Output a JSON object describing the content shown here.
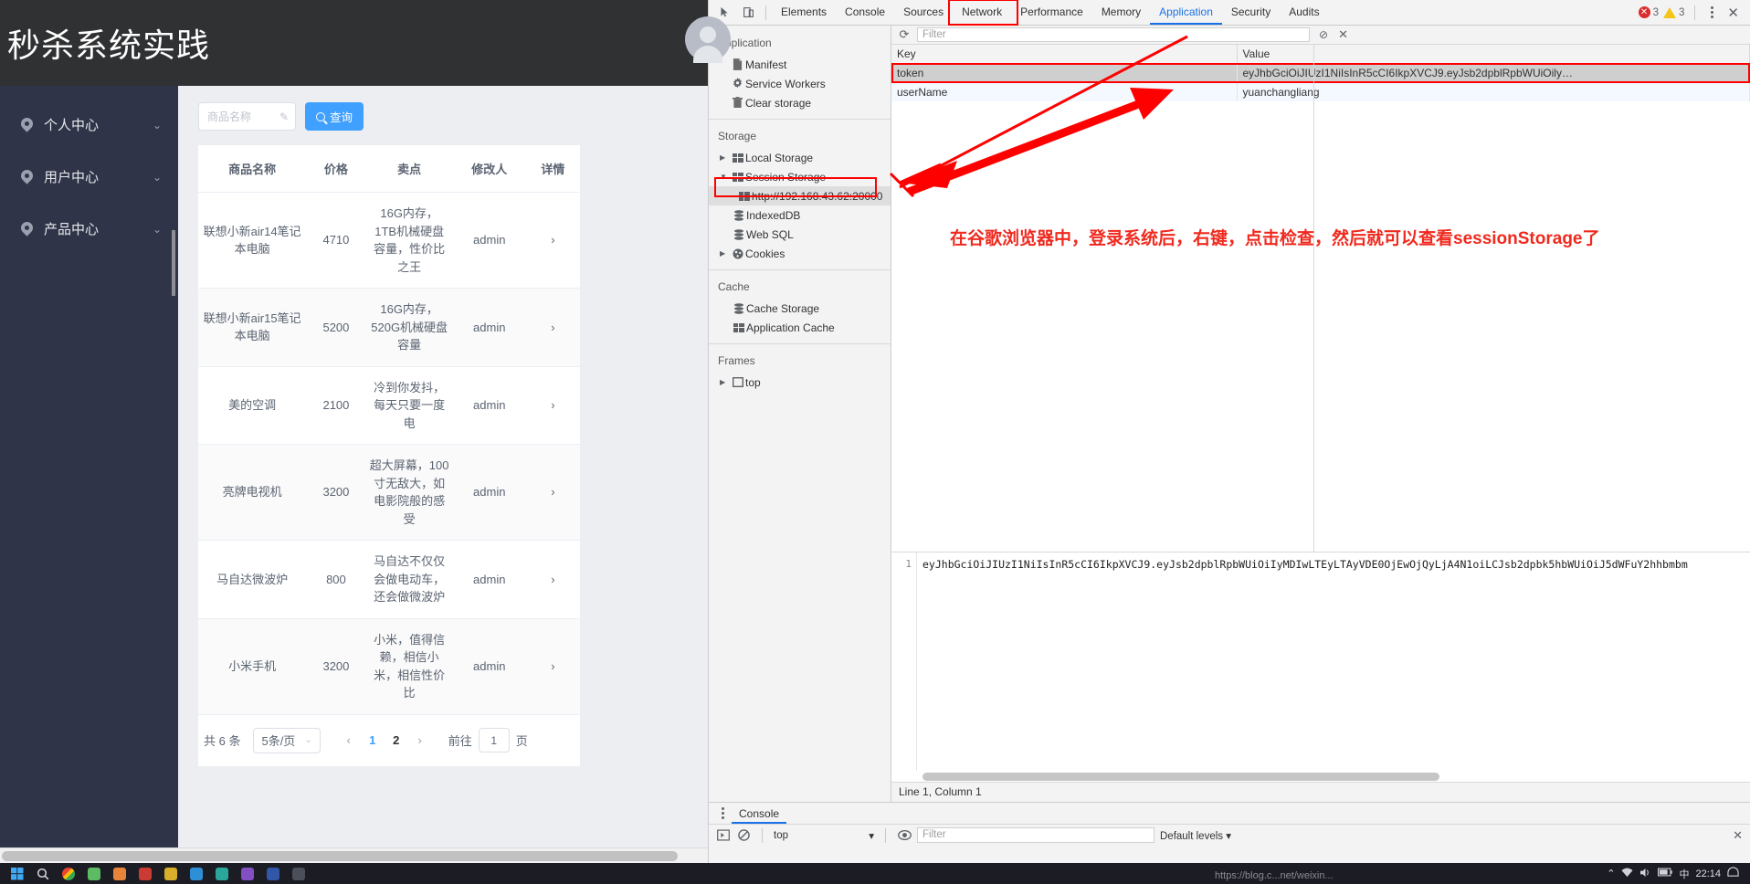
{
  "app": {
    "title": "秒杀系统实践",
    "nav": [
      {
        "label": "个人中心",
        "icon": "location-pin-icon",
        "chevron": "⌄"
      },
      {
        "label": "用户中心",
        "icon": "location-pin-icon",
        "chevron": "⌄"
      },
      {
        "label": "产品中心",
        "icon": "location-pin-icon",
        "chevron": "⌄"
      }
    ],
    "search": {
      "placeholder": "商品名称",
      "value": "",
      "pen_icon": "✎",
      "button_label": "查询"
    },
    "table": {
      "headers": [
        "商品名称",
        "价格",
        "卖点",
        "修改人",
        "详情"
      ],
      "rows": [
        {
          "name": "联想小新air14笔记本电脑",
          "price": "4710",
          "selling": "16G内存，1TB机械硬盘容量，性价比之王",
          "user": "admin",
          "detail": "›"
        },
        {
          "name": "联想小新air15笔记本电脑",
          "price": "5200",
          "selling": "16G内存，520G机械硬盘容量",
          "user": "admin",
          "detail": "›"
        },
        {
          "name": "美的空调",
          "price": "2100",
          "selling": "冷到你发抖，每天只要一度电",
          "user": "admin",
          "detail": "›"
        },
        {
          "name": "亮牌电视机",
          "price": "3200",
          "selling": "超大屏幕，100寸无敌大，如电影院般的感受",
          "user": "admin",
          "detail": "›"
        },
        {
          "name": "马自达微波炉",
          "price": "800",
          "selling": "马自达不仅仅会做电动车，还会做微波炉",
          "user": "admin",
          "detail": "›"
        },
        {
          "name": "小米手机",
          "price": "3200",
          "selling": "小米，值得信赖，相信小米，相信性价比",
          "user": "admin",
          "detail": "›"
        }
      ]
    },
    "pager": {
      "total": "共 6 条",
      "page_size": "5条/页",
      "page_size_caret": "⌄",
      "prev": "‹",
      "next": "›",
      "pages": [
        "1",
        "2"
      ],
      "current_page": "2",
      "jump_label": "前往",
      "jump_value": "1",
      "jump_suffix": "页"
    }
  },
  "devtools": {
    "toolbar_icons": [
      "inspect-element-icon",
      "device-toolbar-icon"
    ],
    "tabs": [
      "Elements",
      "Console",
      "Sources",
      "Network",
      "Performance",
      "Memory",
      "Application",
      "Security",
      "Audits"
    ],
    "active_tab": "Application",
    "error_count": "3",
    "warning_count": "3",
    "more_icon": "kebab-menu-icon",
    "close_icon": "✕",
    "sidebar": {
      "sections": [
        {
          "title": "Application",
          "items": [
            {
              "label": "Manifest",
              "icon": "document-icon",
              "twisty": ""
            },
            {
              "label": "Service Workers",
              "icon": "gear-icon",
              "twisty": ""
            },
            {
              "label": "Clear storage",
              "icon": "trash-icon",
              "twisty": ""
            }
          ]
        },
        {
          "title": "Storage",
          "items": [
            {
              "label": "Local Storage",
              "icon": "table-icon",
              "twisty": "▶"
            },
            {
              "label": "Session Storage",
              "icon": "table-icon",
              "twisty": "▼"
            },
            {
              "label": "http://192.168.43.62:20000",
              "icon": "table-icon",
              "twisty": "",
              "selected": true,
              "indent": true
            },
            {
              "label": "IndexedDB",
              "icon": "database-icon",
              "twisty": ""
            },
            {
              "label": "Web SQL",
              "icon": "database-icon",
              "twisty": ""
            },
            {
              "label": "Cookies",
              "icon": "cookie-icon",
              "twisty": "▶"
            }
          ]
        },
        {
          "title": "Cache",
          "items": [
            {
              "label": "Cache Storage",
              "icon": "database-icon",
              "twisty": ""
            },
            {
              "label": "Application Cache",
              "icon": "table-icon",
              "twisty": ""
            }
          ]
        },
        {
          "title": "Frames",
          "items": [
            {
              "label": "top",
              "icon": "frame-icon",
              "twisty": "▶"
            }
          ]
        }
      ]
    },
    "kv_toolbar": {
      "refresh_icon": "⟳",
      "filter_placeholder": "Filter",
      "clear_icon": "⊘",
      "delete_icon": "✕"
    },
    "kv_table": {
      "headers": [
        "Key",
        "Value"
      ],
      "rows": [
        {
          "key": "token",
          "value": "eyJhbGciOiJIUzI1NiIsInR5cCI6IkpXVCJ9.eyJsb2dpblRpbWUiOily…",
          "selected": true
        },
        {
          "key": "userName",
          "value": "yuanchangliang",
          "selected": false
        }
      ]
    },
    "preview": {
      "line_number": "1",
      "code": "eyJhbGciOiJIUzI1NiIsInR5cCI6IkpXVCJ9.eyJsb2dpblRpbWUiOiIyMDIwLTEyLTAyVDE0OjEwOjQyLjA4N1oiLCJsb2dpbk5hbWUiOiJ5dWFuY2hhbmbm"
    },
    "status_line": "Line 1, Column 1",
    "drawer": {
      "menu_icon": "kebab-menu-icon",
      "tab": "Console",
      "execute_icon": "execution-context-icon",
      "clear_icon": "clear-console-icon",
      "context": "top",
      "context_caret": "▾",
      "eye_icon": "live-expression-icon",
      "filter_placeholder": "Filter",
      "levels": "Default levels ▾",
      "close_icon": "✕"
    }
  },
  "annotation": {
    "text": "在谷歌浏览器中，登录系统后，右键，点击检查，然后就可以查看sessionStorage了",
    "color": "#ef2a1f"
  },
  "taskbar": {
    "icons": [
      "start-icon",
      "search-icon",
      "chrome-icon",
      "app-green-icon",
      "app-orange-icon",
      "app-red-icon",
      "app-yellow-icon",
      "app-blue-icon",
      "app-teal-icon",
      "app-purple-icon",
      "app-indigo-icon",
      "app-dark-icon"
    ],
    "tray_time": "22:14",
    "tray_icons": [
      "up-chevron-icon",
      "network-icon",
      "volume-icon",
      "battery-icon",
      "ime-icon"
    ],
    "watermark": "https://blog.c...net/weixin..."
  }
}
